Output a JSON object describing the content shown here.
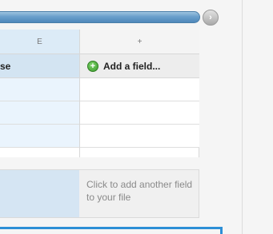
{
  "scroll": {
    "next_symbol": "›"
  },
  "grid": {
    "columns": [
      {
        "letter": "E",
        "header": "se"
      },
      {
        "letter": "+",
        "header": "Add a field..."
      }
    ]
  },
  "footer": {
    "hint": "Click to add another field to your file"
  },
  "colors": {
    "selected_column": "#dcebf7",
    "scrollbar": "#5f97c6",
    "add_icon": "#4caf3a",
    "frame_border": "#2d8fd6"
  },
  "icons": {
    "add_field": "plus-circle-icon",
    "scroll_next": "chevron-right-icon"
  }
}
